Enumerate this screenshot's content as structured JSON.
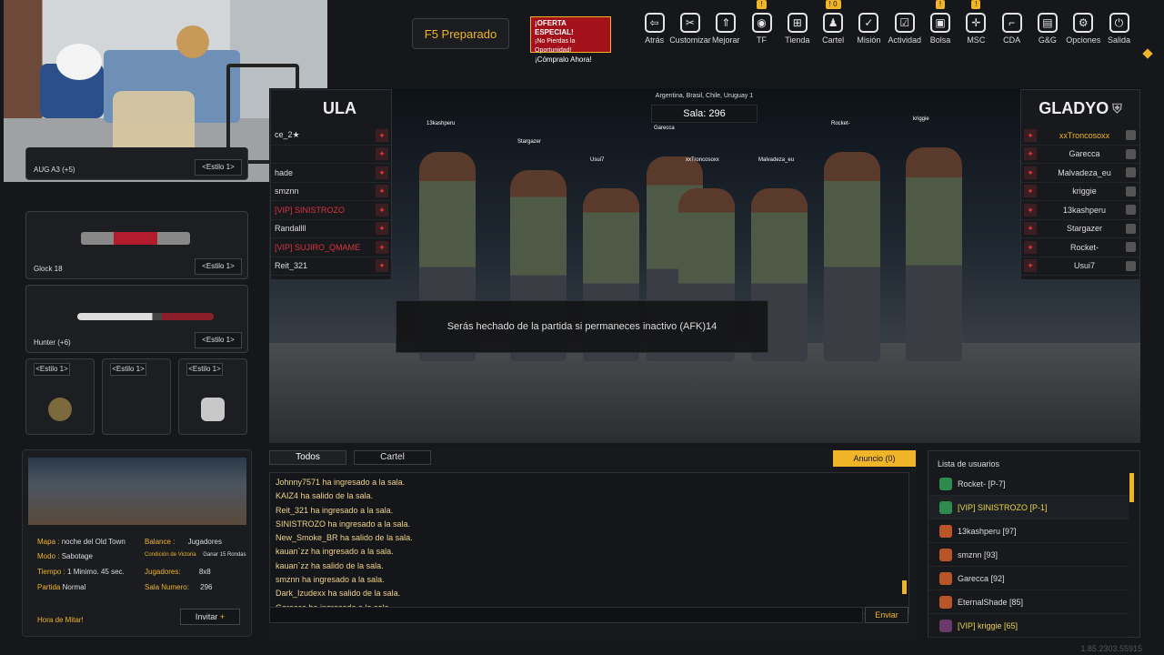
{
  "header": {
    "status": "F5  Preparado",
    "offer": {
      "title": "¡OFERTA ESPECIAL!",
      "line2": "¡No Pierdas la Oportunidad!",
      "cta": "¡Cómpralo Ahora!"
    },
    "nav": [
      {
        "label": "Atrás",
        "icon": "back-icon",
        "glyph": "⇦",
        "badge": ""
      },
      {
        "label": "Customizar",
        "icon": "wrench-icon",
        "glyph": "✂",
        "badge": ""
      },
      {
        "label": "Mejorar",
        "icon": "upgrade-icon",
        "glyph": "⇑",
        "badge": ""
      },
      {
        "label": "TF",
        "icon": "tf-icon",
        "glyph": "◉",
        "badge": "!"
      },
      {
        "label": "Tienda",
        "icon": "cart-icon",
        "glyph": "⊞",
        "badge": ""
      },
      {
        "label": "Cartel",
        "icon": "clan-icon",
        "glyph": "♟",
        "badge": "! 0"
      },
      {
        "label": "Misión",
        "icon": "mission-icon",
        "glyph": "✓",
        "badge": ""
      },
      {
        "label": "Actividad",
        "icon": "calendar-icon",
        "glyph": "☑",
        "badge": ""
      },
      {
        "label": "Bolsa",
        "icon": "bag-icon",
        "glyph": "▣",
        "badge": "!"
      },
      {
        "label": "MSC",
        "icon": "crosshair-icon",
        "glyph": "✛",
        "badge": "!"
      },
      {
        "label": "CDA",
        "icon": "gun-icon",
        "glyph": "⌐",
        "badge": ""
      },
      {
        "label": "G&G",
        "icon": "gg-icon",
        "glyph": "▤",
        "badge": ""
      },
      {
        "label": "Opciones",
        "icon": "gear-icon",
        "glyph": "⚙",
        "badge": ""
      },
      {
        "label": "Salida",
        "icon": "power-icon",
        "glyph": "⏻",
        "badge": ""
      }
    ]
  },
  "loadout": {
    "weapons": [
      {
        "name": "AUG A3 (+5)",
        "style": "<Estilo 1>"
      },
      {
        "name": "Glock 18",
        "style": "<Estilo 1>"
      },
      {
        "name": "Hunter (+6)",
        "style": "<Estilo 1>"
      }
    ],
    "throwables": [
      {
        "style": "<Estilo 1>",
        "color": "#7d6a3c"
      },
      {
        "style": "<Estilo 1>",
        "color": ""
      },
      {
        "style": "<Estilo 1>",
        "color": "#c8c8c8"
      }
    ]
  },
  "room_info": {
    "map_label": "Mapa :",
    "map": "noche del Old Town",
    "mode_label": "Modo :",
    "mode": "Sabotage",
    "time_label": "Tiempo :",
    "time": "1 Minimo. 45 sec.",
    "match_label": "Partida",
    "match": "Normal",
    "balance_label": "Balance :",
    "balance": "Jugadores",
    "victory_label": "Condición de Victoria",
    "victory": "Ganar 15 Rondas",
    "players_label": "Jugadores:",
    "players": "8x8",
    "room_label": "Sala Numero:",
    "room": "296",
    "mitar": "Hora de Mitar!",
    "invite": "Invitar",
    "invite_icon": "+"
  },
  "server": {
    "regions": "Argentina, Brasil, Chile, Uruguay 1",
    "sala": "Sala: 296"
  },
  "afk_message": "Serás hechado de la partida si permaneces inactivo (AFK)14",
  "team_left": {
    "name": "ULA",
    "players": [
      {
        "name": "ce_2★",
        "vip": false
      },
      {
        "name": "",
        "vip": false
      },
      {
        "name": "hade",
        "vip": false
      },
      {
        "name": "smznn",
        "vip": false
      },
      {
        "name": "[VIP] SINISTROZO",
        "vip": true
      },
      {
        "name": "Randallll",
        "vip": false
      },
      {
        "name": "[VIP] SUJIRO_QMAME",
        "vip": true
      },
      {
        "name": "Reit_321",
        "vip": false
      }
    ]
  },
  "team_right": {
    "name": "GLADYO",
    "players": [
      {
        "name": "xxTroncosoxx",
        "gold": true
      },
      {
        "name": "Garecca",
        "gold": false
      },
      {
        "name": "Malvadeza_eu",
        "gold": false
      },
      {
        "name": "kriggie",
        "gold": false
      },
      {
        "name": "13kashperu",
        "gold": false
      },
      {
        "name": "Stargazer",
        "gold": false
      },
      {
        "name": "Rocket-",
        "gold": false
      },
      {
        "name": "Usui7",
        "gold": false
      }
    ]
  },
  "scene_names": [
    "13kashperu",
    "Stargazer",
    "Usui7",
    "Garecca",
    "xxTroncosoxx",
    "Malvadeza_eu",
    "Rocket-",
    "kriggie"
  ],
  "chat": {
    "tabs": [
      "Todos",
      "Cartel"
    ],
    "announcement": "Anuncio (0)",
    "send": "Enviar",
    "messages": [
      "Johnny7571 ha ingresado a la sala.",
      "KAIZ4 ha salido de la sala.",
      "Reit_321 ha ingresado a la sala.",
      "SINISTROZO ha ingresado a la sala.",
      "New_Smoke_BR ha salido de la sala.",
      "kauan`zz ha ingresado a la sala.",
      "kauan`zz ha salido de la sala.",
      "smznn ha ingresado a la sala.",
      "Dark_Izudexx ha salido de la sala.",
      "Garecca ha ingresado a la sala."
    ]
  },
  "userlist": {
    "title": "Lista de usuarios",
    "users": [
      {
        "name": "Rocket- [P-7]",
        "vip": false,
        "color": "#2f8a4e"
      },
      {
        "name": "[VIP] SINISTROZO [P-1]",
        "vip": true,
        "color": "#2f8a4e"
      },
      {
        "name": "13kashperu [97]",
        "vip": false,
        "color": "#b8562a"
      },
      {
        "name": "smznn [93]",
        "vip": false,
        "color": "#b8562a"
      },
      {
        "name": "Garecca [92]",
        "vip": false,
        "color": "#b8562a"
      },
      {
        "name": "EternalShade [85]",
        "vip": false,
        "color": "#b8562a"
      },
      {
        "name": "[VIP] kriggie [65]",
        "vip": true,
        "color": "#6a3a6a"
      }
    ]
  },
  "version": "1.85.2303.55915"
}
